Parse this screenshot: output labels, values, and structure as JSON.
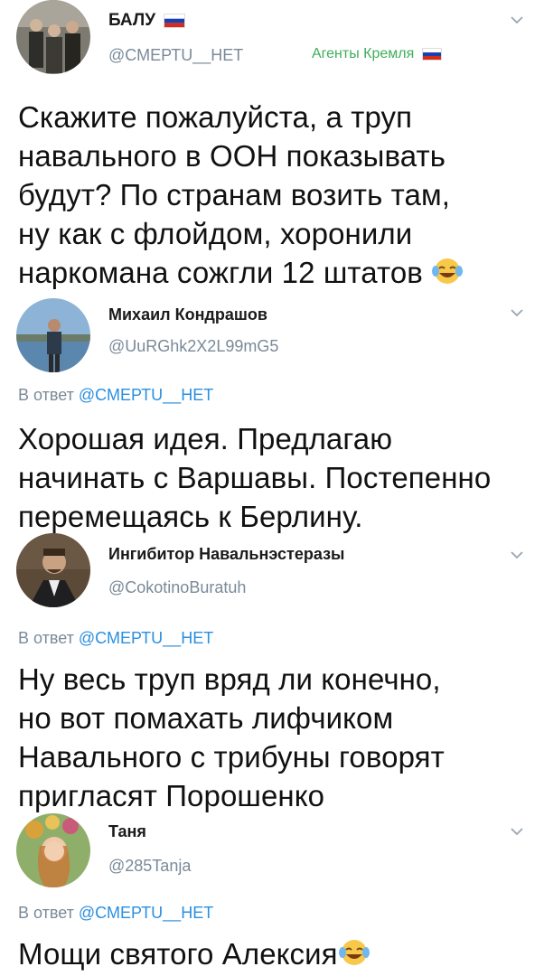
{
  "tweets": [
    {
      "name": "БАЛУ",
      "handle": "@СМЕРТU__НЕТ",
      "tag": "Агенты Кремля",
      "body_lines": [
        "Скажите пожалуйста, а труп",
        "навального в ООН показывать",
        "будут? По странам возить там,",
        "ну как с флойдом, хоронили",
        "наркомана сожгли 12 штатов"
      ]
    },
    {
      "name": "Михаил Кондрашов",
      "handle": "@UuRGhk2X2L99mG5",
      "reply_prefix": "В ответ",
      "reply_mention": "@СМЕРТU__НЕТ",
      "body_lines": [
        "Хорошая идея. Предлагаю",
        "начинать с Варшавы. Постепенно",
        "перемещаясь к Берлину."
      ]
    },
    {
      "name": "Ингибитор Навальнэстеразы",
      "handle": "@CokotinoBuratuh",
      "reply_prefix": "В ответ",
      "reply_mention": "@СМЕРТU__НЕТ",
      "body_lines": [
        "Ну весь труп вряд ли конечно,",
        "но вот помахать лифчиком",
        "Навального с трибуны говорят",
        "пригласят Порошенко"
      ]
    },
    {
      "name": "Таня",
      "handle": "@285Tanja",
      "reply_prefix": "В ответ",
      "reply_mention": "@СМЕРТU__НЕТ",
      "body_lines": [
        "Мощи святого Алексия"
      ]
    }
  ],
  "colors": {
    "mention": "#2a8fe0",
    "secondary": "#7a8a99"
  },
  "icons": {
    "menu": "chevron-down-icon",
    "laugh": "face-with-tears-of-joy-emoji",
    "flag": "russian-flag-icon"
  }
}
